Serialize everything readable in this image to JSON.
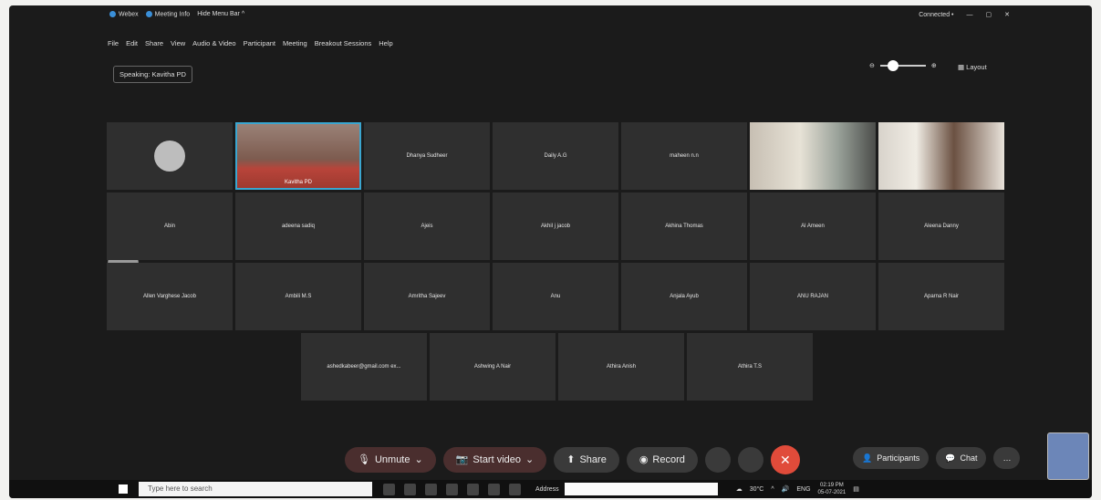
{
  "titlebar": {
    "app": "Webex",
    "meeting_info": "Meeting Info",
    "hide_menu": "Hide Menu Bar ^",
    "status": "Connected •"
  },
  "menu": [
    "File",
    "Edit",
    "Share",
    "View",
    "Audio & Video",
    "Participant",
    "Meeting",
    "Breakout Sessions",
    "Help"
  ],
  "speaking": "Speaking: Kavitha PD",
  "layout_label": "Layout",
  "tiles": {
    "row1": [
      "",
      "Kavitha PD",
      "Dhanya Sudheer",
      "Daily A.G",
      "maheen n.n",
      "",
      ""
    ],
    "row2": [
      "Abin",
      "adeena sadiq",
      "Ajeis",
      "Akhil j jacob",
      "Akhina Thomas",
      "Al Ameen",
      "Aleena Danny"
    ],
    "row3": [
      "Allen Varghese Jacob",
      "Ambili M.S",
      "Amritha Sajeev",
      "Anu",
      "Anjala Ayub",
      "ANU RAJAN",
      "Aparna R Nair"
    ],
    "row4": [
      "ashedkabeer@gmail.com ex...",
      "Ashwing A Nair",
      "Athira Anish",
      "Athira T.S"
    ]
  },
  "controls": {
    "unmute": "Unmute",
    "start_video": "Start video",
    "share": "Share",
    "record": "Record",
    "participants": "Participants",
    "chat": "Chat"
  },
  "taskbar": {
    "search_placeholder": "Type here to search",
    "address": "Address",
    "weather": "30°C",
    "lang": "ENG",
    "time": "02:19 PM",
    "date": "05-07-2021"
  }
}
